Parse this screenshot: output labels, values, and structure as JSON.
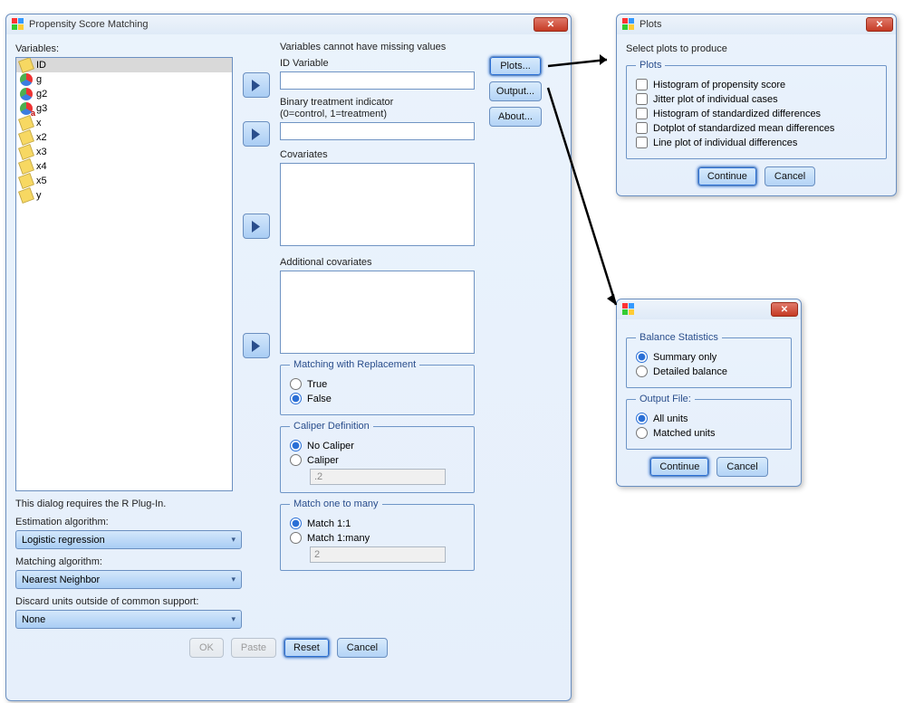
{
  "main": {
    "title": "Propensity Score Matching",
    "variables_label": "Variables:",
    "missing_note": "Variables cannot have missing values",
    "vars": [
      {
        "name": "ID",
        "icon": "ruler",
        "sel": true
      },
      {
        "name": "g",
        "icon": "nominal"
      },
      {
        "name": "g2",
        "icon": "nominal"
      },
      {
        "name": "g3",
        "icon": "nominal-a"
      },
      {
        "name": "x",
        "icon": "ruler"
      },
      {
        "name": "x2",
        "icon": "ruler"
      },
      {
        "name": "x3",
        "icon": "ruler"
      },
      {
        "name": "x4",
        "icon": "ruler"
      },
      {
        "name": "x5",
        "icon": "ruler"
      },
      {
        "name": "y",
        "icon": "ruler"
      }
    ],
    "id_var_label": "ID Variable",
    "binary_label_1": "Binary treatment indicator",
    "binary_label_2": "(0=control, 1=treatment)",
    "covariates_label": "Covariates",
    "addl_cov_label": "Additional covariates",
    "replace_legend": "Matching with Replacement",
    "replace_true": "True",
    "replace_false": "False",
    "caliper_legend": "Caliper Definition",
    "caliper_no": "No Caliper",
    "caliper_yes": "Caliper",
    "caliper_val": ".2",
    "ratio_legend": "Match one to many",
    "ratio_one": "Match 1:1",
    "ratio_many": "Match 1:many",
    "ratio_val": "2",
    "plugin_note": "This dialog requires the R Plug-In.",
    "est_alg_label": "Estimation algorithm:",
    "est_alg_value": "Logistic regression",
    "match_alg_label": "Matching algorithm:",
    "match_alg_value": "Nearest Neighbor",
    "discard_label": "Discard units outside of common support:",
    "discard_value": "None",
    "side": {
      "plots": "Plots...",
      "output": "Output...",
      "about": "About..."
    },
    "footer": {
      "ok": "OK",
      "paste": "Paste",
      "reset": "Reset",
      "cancel": "Cancel"
    }
  },
  "plots": {
    "title": "Plots",
    "instruction": "Select plots to produce",
    "legend": "Plots",
    "opts": [
      "Histogram of propensity score",
      "Jitter plot of individual cases",
      "Histogram of standardized differences",
      "Dotplot of standardized mean differences",
      "Line plot of individual differences"
    ],
    "continue": "Continue",
    "cancel": "Cancel"
  },
  "output": {
    "balance_legend": "Balance Statistics",
    "summary": "Summary only",
    "detailed": "Detailed balance",
    "file_legend": "Output File:",
    "all": "All units",
    "matched": "Matched units",
    "continue": "Continue",
    "cancel": "Cancel"
  }
}
